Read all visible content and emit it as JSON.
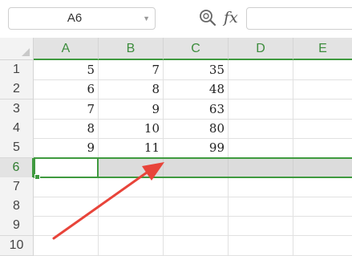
{
  "formula_bar": {
    "name_box": "A6",
    "zoom_icon": "zoom-formula-icon",
    "fx_label": "fx",
    "formula_value": ""
  },
  "columns": [
    "A",
    "B",
    "C",
    "D",
    "E"
  ],
  "rows": [
    {
      "num": "1",
      "cells": [
        "5",
        "7",
        "35",
        "",
        ""
      ]
    },
    {
      "num": "2",
      "cells": [
        "6",
        "8",
        "48",
        "",
        ""
      ]
    },
    {
      "num": "3",
      "cells": [
        "7",
        "9",
        "63",
        "",
        ""
      ]
    },
    {
      "num": "4",
      "cells": [
        "8",
        "10",
        "80",
        "",
        ""
      ]
    },
    {
      "num": "5",
      "cells": [
        "9",
        "11",
        "99",
        "",
        ""
      ]
    },
    {
      "num": "6",
      "cells": [
        "",
        "",
        "",
        "",
        ""
      ]
    },
    {
      "num": "7",
      "cells": [
        "",
        "",
        "",
        "",
        ""
      ]
    },
    {
      "num": "8",
      "cells": [
        "",
        "",
        "",
        "",
        ""
      ]
    },
    {
      "num": "9",
      "cells": [
        "",
        "",
        "",
        "",
        ""
      ]
    },
    {
      "num": "10",
      "cells": [
        "",
        "",
        "",
        "",
        ""
      ]
    }
  ],
  "selected_row": "6",
  "annotation": {
    "type": "arrow",
    "color": "#e8443a"
  },
  "colors": {
    "accent": "#3f9a3f",
    "header_bg": "#e3e3e3",
    "selection_bg": "#dcdcdc"
  }
}
